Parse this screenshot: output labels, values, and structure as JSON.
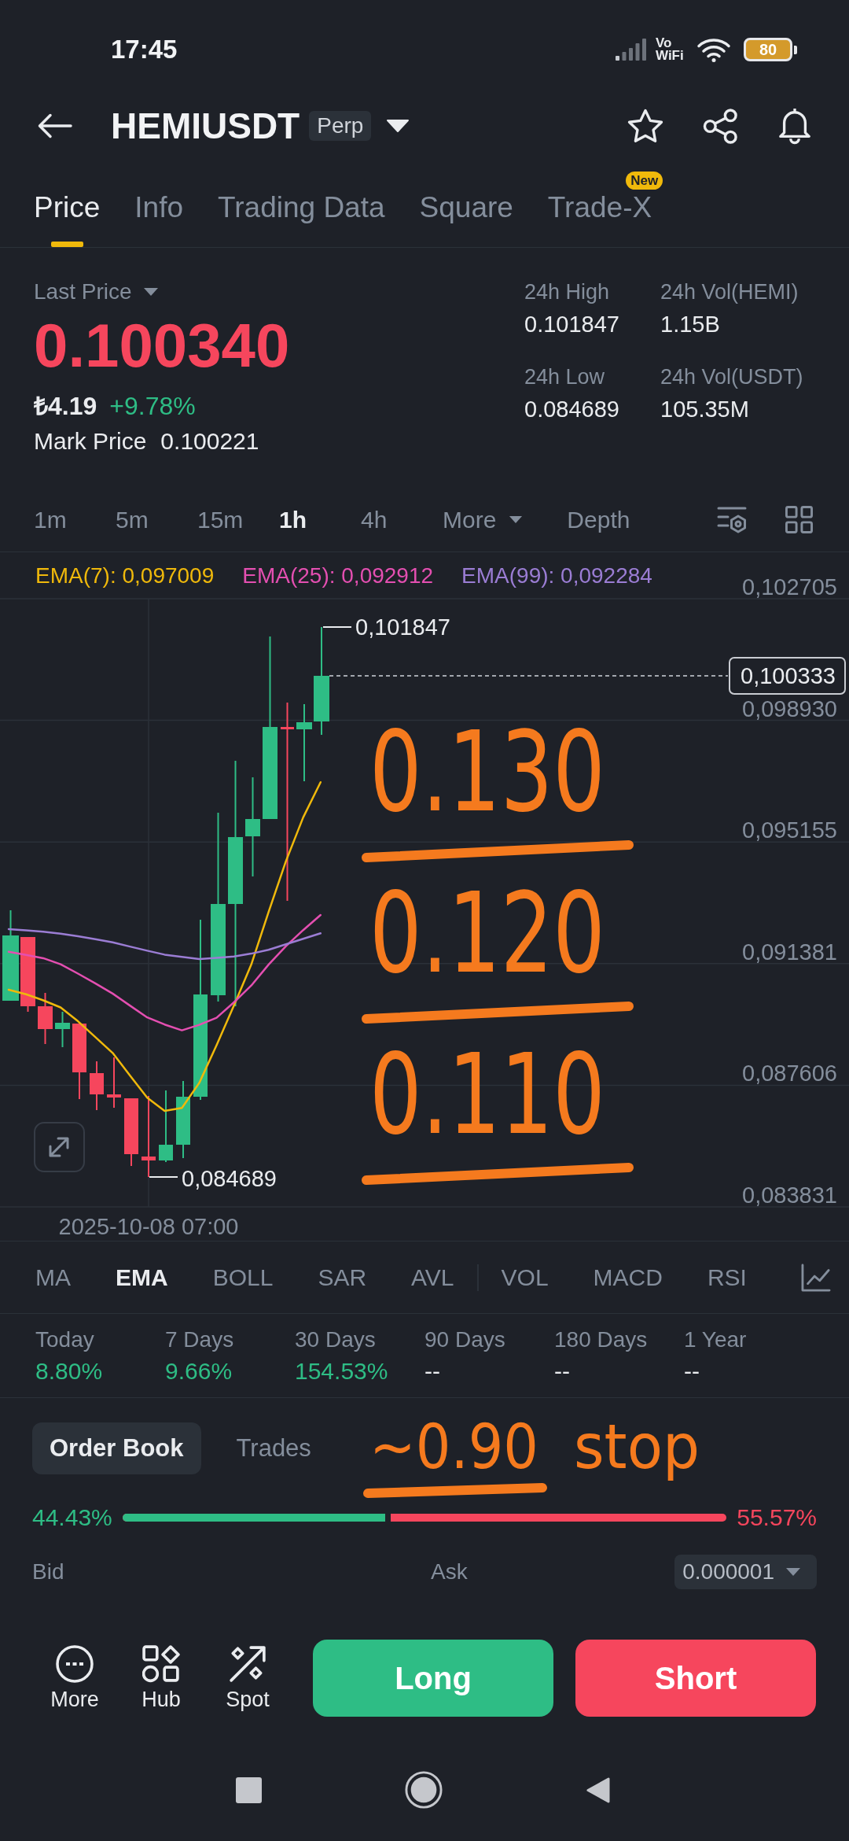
{
  "status_bar": {
    "time": "17:45",
    "wifi_calling": "Vo WiFi",
    "battery": "80"
  },
  "header": {
    "symbol": "HEMIUSDT",
    "contract_type": "Perp"
  },
  "tabs": [
    {
      "label": "Price",
      "selected": true
    },
    {
      "label": "Info",
      "selected": false
    },
    {
      "label": "Trading Data",
      "selected": false
    },
    {
      "label": "Square",
      "selected": false
    },
    {
      "label": "Trade-X",
      "selected": false,
      "badge": "New"
    }
  ],
  "price_panel": {
    "price_type": "Last Price",
    "last_price": "0.100340",
    "local_price": "₺4.19",
    "change": "+9.78%",
    "mark_price_label": "Mark Price",
    "mark_price": "0.100221",
    "stats": [
      {
        "label": "24h High",
        "value": "0.101847"
      },
      {
        "label": "24h Vol(HEMI)",
        "value": "1.15B"
      },
      {
        "label": "24h Low",
        "value": "0.084689"
      },
      {
        "label": "24h Vol(USDT)",
        "value": "105.35M"
      }
    ]
  },
  "intervals": [
    {
      "label": "1m",
      "selected": false,
      "kind": "option"
    },
    {
      "label": "5m",
      "selected": false,
      "kind": "option"
    },
    {
      "label": "15m",
      "selected": false,
      "kind": "option"
    },
    {
      "label": "1h",
      "selected": true,
      "kind": "option"
    },
    {
      "label": "4h",
      "selected": false,
      "kind": "option"
    },
    {
      "label": "More",
      "selected": false,
      "kind": "menu"
    },
    {
      "label": "Depth",
      "selected": false,
      "kind": "option"
    }
  ],
  "chart": {
    "current_price": "0,100333",
    "high_marker": "0,101847",
    "low_marker": "0,084689",
    "time_label": "2025-10-08 07:00",
    "chart_data": {
      "type": "line",
      "grid": true,
      "categories": [
        null,
        null,
        null,
        null,
        null,
        null,
        null,
        null,
        null,
        null,
        null,
        null,
        null,
        null,
        null,
        null,
        null,
        null,
        null,
        null,
        null,
        null,
        null,
        null,
        null,
        null,
        null,
        null,
        null,
        null,
        null,
        null,
        null,
        null,
        null,
        null,
        null,
        null,
        null,
        null,
        null,
        null,
        null,
        null,
        null,
        null,
        null,
        null,
        null
      ],
      "ylim": [
        0.083831,
        0.102705
      ],
      "yticks": [
        {
          "value": 0.102705,
          "label": "0,102705"
        },
        {
          "value": 0.09893,
          "label": "0,098930"
        },
        {
          "value": 0.095155,
          "label": "0,095155"
        },
        {
          "value": 0.091381,
          "label": "0,091381"
        },
        {
          "value": 0.087606,
          "label": "0,087606"
        },
        {
          "value": 0.083831,
          "label": "0,083831"
        }
      ],
      "series": [
        {
          "name": "EMA(7): 0,097009",
          "color": "#f0b90b",
          "values": [
            0.09057,
            0.09043,
            0.09024,
            0.09002,
            0.08959,
            0.0891,
            0.08861,
            0.08791,
            0.08722,
            0.08681,
            0.0869,
            0.08768,
            0.08885,
            0.09008,
            0.09135,
            0.09298,
            0.09456,
            0.09592,
            0.09701,
            null,
            null,
            null,
            null,
            null,
            null,
            null,
            null,
            null,
            null,
            null,
            null,
            null,
            null,
            null,
            null,
            null,
            null,
            null,
            null,
            null,
            null,
            null,
            null,
            null,
            null,
            null,
            null,
            null,
            null
          ]
        },
        {
          "name": "EMA(25): 0,092912",
          "color": "#e44fb1",
          "values": [
            0.09175,
            0.09165,
            0.09155,
            0.09136,
            0.09107,
            0.09077,
            0.09045,
            0.09008,
            0.08971,
            0.08949,
            0.08931,
            0.08948,
            0.0897,
            0.09018,
            0.0907,
            0.09135,
            0.09192,
            0.09242,
            0.09289,
            null,
            null,
            null,
            null,
            null,
            null,
            null,
            null,
            null,
            null,
            null,
            null,
            null,
            null,
            null,
            null,
            null,
            null,
            null,
            null,
            null,
            null,
            null,
            null,
            null,
            null,
            null,
            null,
            null,
            null
          ]
        },
        {
          "name": "EMA(99): 0,092284",
          "color": "#9b7dd4",
          "values": [
            0.09245,
            0.09241,
            0.09237,
            0.09231,
            0.09223,
            0.09214,
            0.09204,
            0.09191,
            0.09178,
            0.09166,
            0.09159,
            0.09152,
            0.09156,
            0.0916,
            0.09169,
            0.09181,
            0.09198,
            0.09215,
            0.09232,
            null,
            null,
            null,
            null,
            null,
            null,
            null,
            null,
            null,
            null,
            null,
            null,
            null,
            null,
            null,
            null,
            null,
            null,
            null,
            null,
            null,
            null,
            null,
            null,
            null,
            null,
            null,
            null,
            null,
            null
          ]
        }
      ]
    }
  },
  "indicators": {
    "main": [
      {
        "label": "MA",
        "selected": false
      },
      {
        "label": "EMA",
        "selected": true
      },
      {
        "label": "BOLL",
        "selected": false
      },
      {
        "label": "SAR",
        "selected": false
      },
      {
        "label": "AVL",
        "selected": false
      }
    ],
    "sub": [
      {
        "label": "VOL",
        "selected": false
      },
      {
        "label": "MACD",
        "selected": false
      },
      {
        "label": "RSI",
        "selected": false
      }
    ]
  },
  "performance": [
    {
      "label": "Today",
      "value": "8.80%",
      "positive": true
    },
    {
      "label": "7 Days",
      "value": "9.66%",
      "positive": true
    },
    {
      "label": "30 Days",
      "value": "154.53%",
      "positive": true
    },
    {
      "label": "90 Days",
      "value": "--",
      "positive": false
    },
    {
      "label": "180 Days",
      "value": "--",
      "positive": false
    },
    {
      "label": "1 Year",
      "value": "--",
      "positive": false
    }
  ],
  "order_book": {
    "tabs": [
      {
        "label": "Order Book",
        "selected": true
      },
      {
        "label": "Trades",
        "selected": false
      }
    ],
    "bid_share": "44.43%",
    "ask_share": "55.57%",
    "level": 0.4443,
    "bid_label": "Bid",
    "ask_label": "Ask",
    "tick_size": "0.000001"
  },
  "bottom_bar": {
    "tools": [
      {
        "label": "More",
        "kind": "more"
      },
      {
        "label": "Hub",
        "kind": "hub"
      },
      {
        "label": "Spot",
        "kind": "spot"
      }
    ],
    "long": "Long",
    "short": "Short"
  },
  "annotations": [
    {
      "text": "0.130",
      "underlined": true
    },
    {
      "text": "0.120",
      "underlined": true
    },
    {
      "text": "0.110",
      "underlined": true
    },
    {
      "text": "~0.90",
      "underlined": true
    },
    {
      "text": "stop",
      "underlined": false
    }
  ]
}
